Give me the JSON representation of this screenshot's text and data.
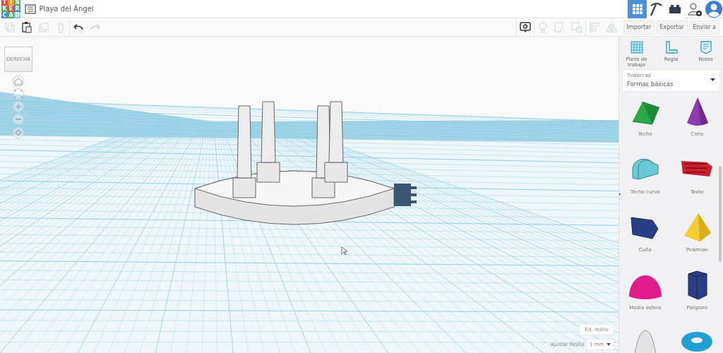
{
  "logo": [
    {
      "letter": "T",
      "color": "#e8453c"
    },
    {
      "letter": "I",
      "color": "#f39a1e"
    },
    {
      "letter": "N",
      "color": "#4caf50"
    },
    {
      "letter": "K",
      "color": "#4caf50"
    },
    {
      "letter": "E",
      "color": "#e8453c"
    },
    {
      "letter": "R",
      "color": "#3f8fd8"
    },
    {
      "letter": "C",
      "color": "#3f8fd8"
    },
    {
      "letter": "A",
      "color": "#4caf50"
    },
    {
      "letter": "D",
      "color": "#7ec8e3"
    }
  ],
  "document_title": "Playa del Ángel",
  "mode_buttons": [
    {
      "kind": "grid",
      "selected": true
    },
    {
      "kind": "pickaxe",
      "selected": false
    },
    {
      "kind": "brick",
      "selected": false
    }
  ],
  "edit_tools": [
    {
      "kind": "copy",
      "disabled": true
    },
    {
      "kind": "paste",
      "disabled": false
    },
    {
      "kind": "duplicate",
      "disabled": true
    },
    {
      "kind": "delete",
      "disabled": true
    },
    {
      "kind": "undo",
      "disabled": false
    },
    {
      "kind": "redo",
      "disabled": true
    }
  ],
  "view_tools": [
    {
      "kind": "note",
      "disabled": false
    },
    {
      "kind": "bulb",
      "disabled": true
    },
    {
      "kind": "group",
      "disabled": true
    },
    {
      "kind": "ungroup",
      "disabled": true
    },
    {
      "kind": "align",
      "disabled": true
    },
    {
      "kind": "mirror",
      "disabled": true
    }
  ],
  "action_buttons": [
    "Importar",
    "Exportar",
    "Enviar a"
  ],
  "panel_tools": [
    {
      "kind": "workplane",
      "label": "Plano de trabajo"
    },
    {
      "kind": "ruler",
      "label": "Regla"
    },
    {
      "kind": "notes",
      "label": "Notes"
    }
  ],
  "library": {
    "label": "Tinkercad",
    "value": "Formas básicas"
  },
  "shapes": [
    {
      "kind": "roof",
      "label": "Techo"
    },
    {
      "kind": "cone",
      "label": "Cono"
    },
    {
      "kind": "curved-roof",
      "label": "Techo curvo"
    },
    {
      "kind": "text",
      "label": "Texto"
    },
    {
      "kind": "wedge",
      "label": "Cuña"
    },
    {
      "kind": "pyramid",
      "label": "Pirámide"
    },
    {
      "kind": "half-sphere",
      "label": "Media esfera"
    },
    {
      "kind": "polygon",
      "label": "Polígono"
    },
    {
      "kind": "paraboloid"
    },
    {
      "kind": "torus"
    }
  ],
  "view_cube": {
    "face": "DERECHA"
  },
  "nav_buttons": [
    {
      "kind": "home"
    },
    {
      "kind": "fit"
    },
    {
      "kind": "zoom-in"
    },
    {
      "kind": "zoom-out"
    },
    {
      "kind": "perspective"
    }
  ],
  "grid_settings": {
    "edit_button": "Ed. rejilla",
    "snap_label": "Ajustar Rejilla",
    "snap_value": "1 mm"
  }
}
